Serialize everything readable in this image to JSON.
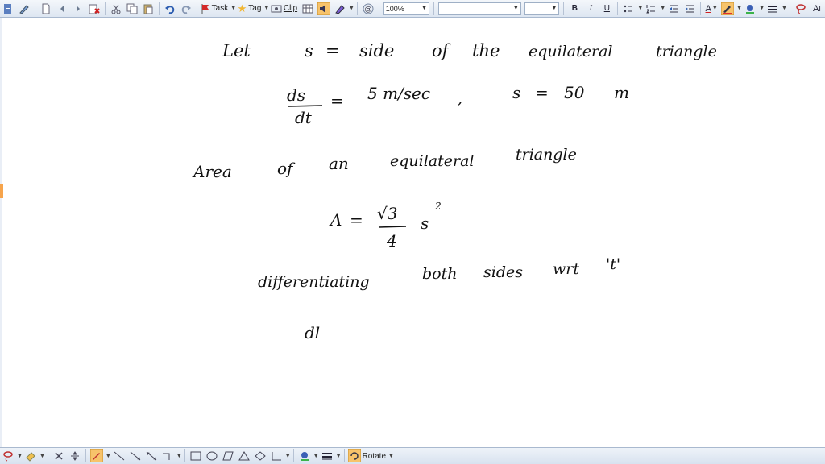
{
  "toolbar": {
    "task_label": "Task",
    "tag_label": "Tag",
    "clip_label": "Clip",
    "zoom_value": "100%",
    "font_name_value": "",
    "font_size_value": "",
    "bold_label": "B",
    "italic_label": "I",
    "underline_label": "U",
    "font_color_label": "A",
    "text_tool_label": "A",
    "text_tool_suffix": "I",
    "icons": [
      "menu-icon",
      "pen-icon",
      "new-page-icon",
      "back-icon",
      "forward-icon",
      "delete-icon",
      "cut-icon",
      "copy-icon",
      "paste-icon",
      "undo-icon",
      "redo-icon",
      "flag-icon",
      "star-icon",
      "clip-icon",
      "table-icon",
      "audio-icon",
      "highlighter-icon",
      "at-icon",
      "bullets-icon",
      "numbering-icon",
      "outdent-icon",
      "indent-icon",
      "pen-color-icon",
      "fill-color-icon",
      "line-style-icon",
      "lasso-icon"
    ]
  },
  "bottom_toolbar": {
    "rotate_label": "Rotate"
  },
  "notes": {
    "line1": {
      "let": "Let",
      "s": "s",
      "eq": "=",
      "side": "side",
      "of": "of",
      "the": "the",
      "equilateral": "equilateral",
      "triangle": "triangle"
    },
    "line2": {
      "num": "ds",
      "den": "dt",
      "eq": "=",
      "rate": "5 m/sec",
      "comma": ",",
      "s": "s",
      "eq2": "=",
      "value": "50",
      "unit": "m"
    },
    "line3": {
      "text1": "Area",
      "text2": "of",
      "text3": "an",
      "text4": "equilateral",
      "text5": "triangle"
    },
    "line4": {
      "A": "A",
      "eq": "=",
      "num": "√3",
      "den": "4",
      "s": "s",
      "exp": "2"
    },
    "line5": {
      "text1": "differentiating",
      "text2": "both",
      "text3": "sides",
      "text4": "wrt",
      "text5": "'t'"
    },
    "line6": {
      "text1": "dl"
    }
  }
}
